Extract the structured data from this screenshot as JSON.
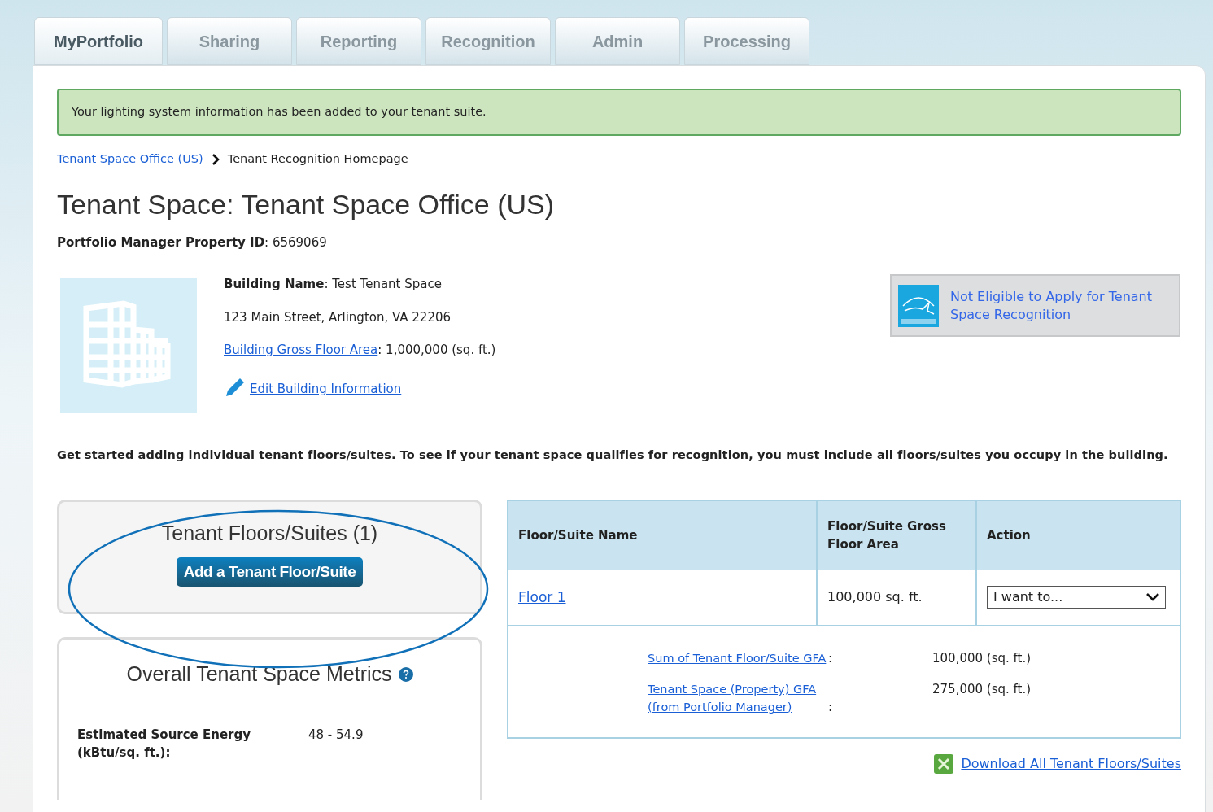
{
  "tabs": [
    {
      "label": "MyPortfolio",
      "selected": true
    },
    {
      "label": "Sharing",
      "selected": false
    },
    {
      "label": "Reporting",
      "selected": false
    },
    {
      "label": "Recognition",
      "selected": false
    },
    {
      "label": "Admin",
      "selected": false
    },
    {
      "label": "Processing",
      "selected": false
    }
  ],
  "alert": {
    "message": "Your lighting system information has been added to your tenant suite."
  },
  "breadcrumb": {
    "link": "Tenant Space Office (US)",
    "current": "Tenant Recognition Homepage"
  },
  "title": "Tenant Space: Tenant Space Office (US)",
  "property_id": "**Portfolio Manager Property ID**: 6569069",
  "building": {
    "name": "**Building Name**: Test Tenant Space",
    "address": "123 Main Street, Arlington, VA 22206",
    "gfa_link": "Building Gross Floor Area",
    "gfa_value": ": 1,000,000 (sq. ft.)",
    "edit_link": "Edit Building Information"
  },
  "eligibility": {
    "text": "Not Eligible to Apply for Tenant Space Recognition"
  },
  "intro": "Get started adding individual tenant floors/suites. To see if your tenant space qualifies for recognition, you must include all floors/suites you occupy in the building.",
  "floors_card": {
    "title": "Tenant Floors/Suites (1)",
    "button": "Add a Tenant Floor/Suite"
  },
  "metrics_card": {
    "title": "Overall Tenant Space Metrics",
    "rows": [
      {
        "label": "Estimated Source Energy (kBtu/sq. ft.):",
        "value": "48 - 54.9"
      }
    ]
  },
  "table": {
    "columns": [
      "Floor/Suite Name",
      "Floor/Suite Gross Floor Area",
      "Action"
    ],
    "rows": [
      {
        "name": "Floor 1",
        "area": "100,000 sq. ft.",
        "action": "I want to..."
      }
    ],
    "summary": [
      {
        "link": "Sum of Tenant Floor/Suite GFA",
        "suffix": ":",
        "value": "100,000 (sq. ft.)"
      },
      {
        "link": "Tenant Space (Property) GFA (from Portfolio Manager)",
        "suffix": ":",
        "value": "275,000 (sq. ft.)"
      }
    ]
  },
  "download_link": "Download All Tenant Floors/Suites"
}
